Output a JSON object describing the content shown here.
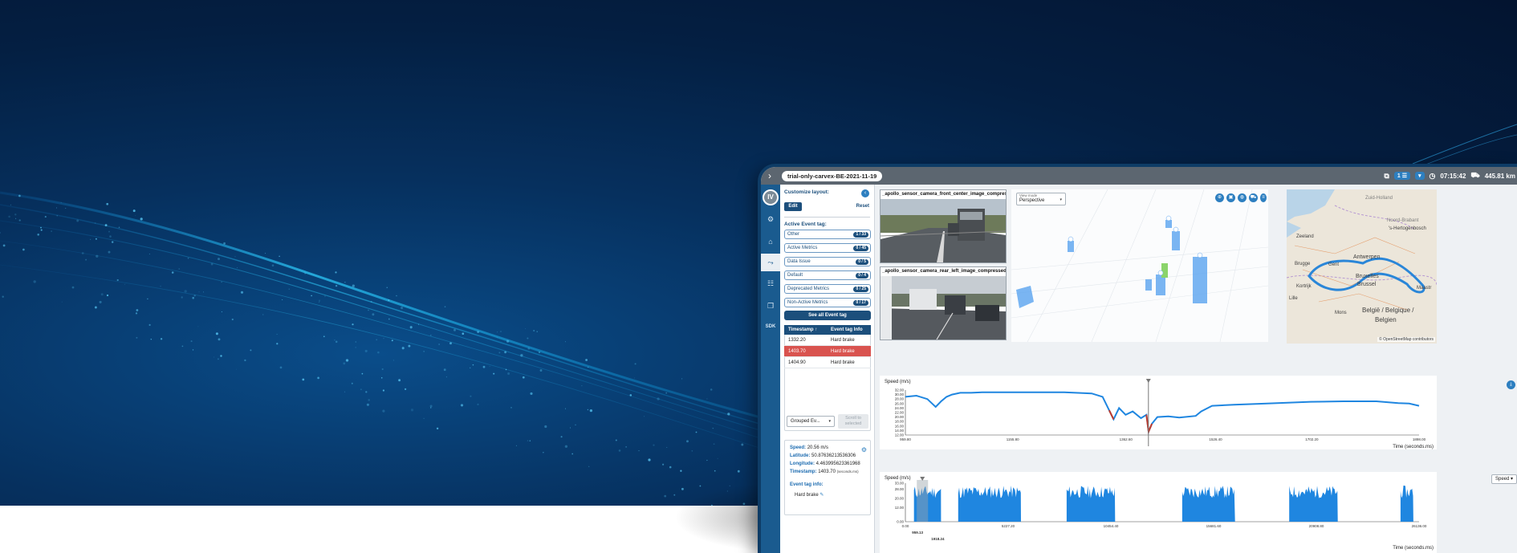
{
  "hero": {
    "wave_color": "#12a6e8"
  },
  "app": {
    "trial_title": "trial-only-carvex-BE-2021-11-19",
    "topbar": {
      "chip_count": "1",
      "time": "07:15:42",
      "distance": "445.81 km"
    }
  },
  "rail": {
    "avatar_initials": "IV",
    "sdk_label": "SDK"
  },
  "left_panel": {
    "customize_layout": "Customize layout:",
    "edit": "Edit",
    "reset": "Reset",
    "active_event_tag": "Active Event tag:",
    "tags": [
      {
        "label": "Other",
        "count": "1 / 33"
      },
      {
        "label": "Active Metrics",
        "count": "0 / 45"
      },
      {
        "label": "Data Issue",
        "count": "0 / 5"
      },
      {
        "label": "Default",
        "count": "0 / 4"
      },
      {
        "label": "Deprecated Metrics",
        "count": "0 / 25"
      },
      {
        "label": "Non-Active Metrics",
        "count": "0 / 17"
      }
    ],
    "see_all": "See all Event tag",
    "table": {
      "col_timestamp": "Timestamp ↑",
      "col_info": "Event tag Info",
      "rows": [
        {
          "timestamp": "1332.20",
          "info": "Hard brake"
        },
        {
          "timestamp": "1403.70",
          "info": "Hard brake"
        },
        {
          "timestamp": "1404.90",
          "info": "Hard brake"
        }
      ]
    },
    "grouped_select": "Grouped Ev...",
    "scroll_button": "Scroll to selected",
    "info": {
      "speed_key": "Speed:",
      "speed_val": "20.56 m/s",
      "lat_key": "Latitude:",
      "lat_val": "50.87636213536306",
      "lon_key": "Longitude:",
      "lon_val": "4.463995623361968",
      "ts_key": "Timestamp:",
      "ts_val": "1403.70",
      "ts_unit": "(seconds.ms)",
      "event_tag_info": "Event tag info:",
      "event_tag_value": "Hard brake"
    }
  },
  "cameras": [
    {
      "title": "_apollo_sensor_camera_front_center_image_compressed"
    },
    {
      "title": "_apollo_sensor_camera_rear_left_image_compressed"
    }
  ],
  "view3d": {
    "view_mode_label": "View mode",
    "view_mode_value": "Perspective"
  },
  "map": {
    "labels": [
      "Zuid-Holland",
      "Noord-Brabant",
      "Zeeland",
      "'s-Hertogenbosch",
      "Antwerpen",
      "Brugge",
      "Gent",
      "Bruxelles",
      "Brussel",
      "Kortrijk",
      "Lille",
      "Mons",
      "Maastr",
      "België / Belgique /",
      "Belgien"
    ],
    "credit": "© OpenStreetMap contributors"
  },
  "chart_data": [
    {
      "type": "line",
      "ylabel": "Speed (m/s)",
      "xlabel": "Time (seconds.ms)",
      "x_ticks": [
        "959.80",
        "1155.80",
        "1362.60",
        "1526.40",
        "1702.20",
        "1898.00"
      ],
      "y_ticks": [
        "32.00",
        "30.00",
        "28.00",
        "26.00",
        "24.00",
        "22.00",
        "20.00",
        "18.00",
        "16.00",
        "14.00",
        "12.00"
      ],
      "xlim": [
        959.8,
        1898.0
      ],
      "ylim": [
        12,
        32
      ],
      "cursor_x": 1403.7,
      "series": [
        {
          "x": [
            959.8,
            980,
            1000,
            1015,
            1025,
            1035,
            1045,
            1060,
            1080,
            1100,
            1150,
            1200,
            1250,
            1300,
            1320,
            1332,
            1340,
            1350,
            1362,
            1375,
            1390,
            1400,
            1404,
            1410,
            1420,
            1440,
            1460,
            1490,
            1500,
            1520,
            1560,
            1620,
            1700,
            1760,
            1820,
            1860,
            1880,
            1898
          ],
          "y": [
            29,
            29.5,
            28,
            24.5,
            27,
            29,
            30,
            30.8,
            30.8,
            31,
            31,
            31,
            31,
            30.5,
            29,
            23,
            19,
            24,
            21,
            22.5,
            19.5,
            21,
            13.5,
            17,
            20,
            20.3,
            19.8,
            20.5,
            22.5,
            25,
            25.5,
            26,
            26.8,
            27,
            27,
            26.2,
            26,
            25
          ]
        }
      ],
      "highlight_ranges": [
        [
          1330,
          1345
        ],
        [
          1395,
          1410
        ]
      ]
    },
    {
      "type": "area",
      "ylabel": "Speed (m/s)",
      "xlabel": "Time (seconds.ms)",
      "x_ticks": [
        "0.00",
        "5227.20",
        "10454.40",
        "15681.60",
        "20908.80",
        "26136.00"
      ],
      "y_ticks": [
        "33.00",
        "28.00",
        "20.00",
        "12.00",
        "0.00"
      ],
      "cursor_labels": [
        "959.13",
        "1918.24"
      ],
      "xlim": [
        0,
        26136
      ],
      "ylim": [
        0,
        33
      ],
      "active_ranges": [
        [
          600,
          2500
        ],
        [
          3700,
          8100
        ],
        [
          11300,
          14700
        ],
        [
          19400,
          23100
        ],
        [
          26900,
          30300
        ],
        [
          34700,
          35600
        ]
      ],
      "note": "dense speed trace, range value approx 18-30 m/s"
    }
  ]
}
